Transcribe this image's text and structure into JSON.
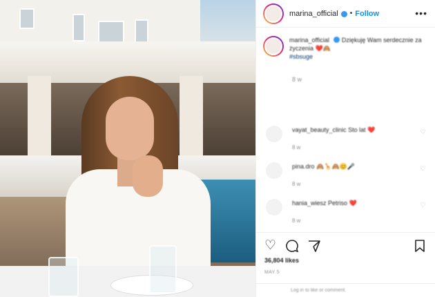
{
  "post": {
    "username": "marina_official",
    "follow_label": "Follow",
    "more_label": "•••",
    "caption": {
      "username": "marina_official",
      "text": " Dziękuję Wam serdecznie za życzenia",
      "emoji": "❤️🙈",
      "hashtag": "#sbsuge",
      "time": "8 w"
    },
    "comments": [
      {
        "username": "vayat_beauty_clinic",
        "text": "Sto lat",
        "emoji": "❤️",
        "meta": "8 w"
      },
      {
        "username": "pina.dro",
        "text": "",
        "emoji": "🙈🦒🙈😊🎤",
        "meta": "8 w"
      },
      {
        "username": "hania_wiesz",
        "text": "Petriso",
        "emoji": "❤️",
        "meta": "8 w"
      }
    ],
    "likes": "36,804 likes",
    "date": "MAY 5",
    "login_prompt": "Log in to like or comment."
  },
  "icons": {
    "heart": "heart-icon",
    "comment": "comment-icon",
    "share": "share-icon",
    "save": "bookmark-icon",
    "more": "more-icon",
    "verified": "verified-badge-icon"
  },
  "colors": {
    "accent": "#0095f6",
    "verified": "#3897f0",
    "hashtag": "#00376b",
    "muted": "#8e8e8e"
  }
}
